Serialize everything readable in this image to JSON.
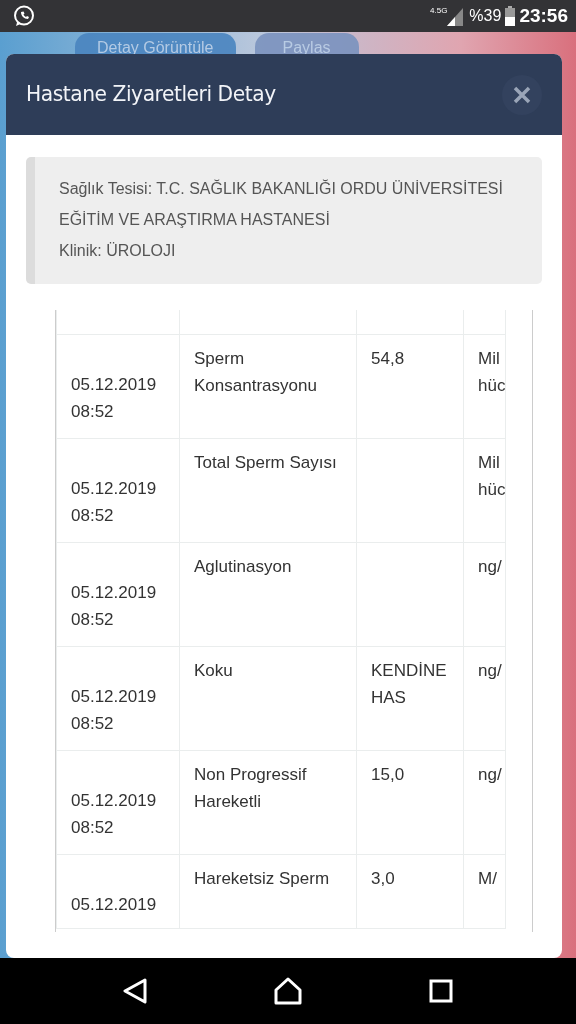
{
  "status_bar": {
    "network": "4.5G",
    "battery": "%39",
    "time": "23:56"
  },
  "background_buttons": [
    "Detay Görüntüle",
    "Paylas"
  ],
  "modal": {
    "title": "Hastane Ziyaretleri Detay",
    "info": [
      "Sağlık Tesisi: T.C. SAĞLIK BAKANLIĞI ORDU ÜNİVERSİTESİ EĞİTİM VE ARAŞTIRMA HASTANESİ",
      "Klinik: ÜROLOJI"
    ],
    "rows": [
      {
        "date": "05.12.2019",
        "time": "08:52",
        "test": "Sperm Konsantrasyonu",
        "value": "54,8",
        "unit": [
          "Mil",
          "hüc"
        ]
      },
      {
        "date": "05.12.2019",
        "time": "08:52",
        "test": "Total Sperm Sayısı",
        "value": "",
        "unit": [
          "Mil",
          "hüc"
        ]
      },
      {
        "date": "05.12.2019",
        "time": "08:52",
        "test": "Aglutinasyon",
        "value": "",
        "unit": [
          "ng/"
        ]
      },
      {
        "date": "05.12.2019",
        "time": "08:52",
        "test": "Koku",
        "value": "KENDİNE HAS",
        "unit": [
          "ng/"
        ]
      },
      {
        "date": "05.12.2019",
        "time": "08:52",
        "test": "Non Progressif Hareketli",
        "value": "15,0",
        "unit": [
          "ng/"
        ]
      },
      {
        "date": "05.12.2019",
        "test": "Hareketsiz Sperm",
        "value": "3,0",
        "unit": [
          "M/"
        ]
      }
    ]
  }
}
